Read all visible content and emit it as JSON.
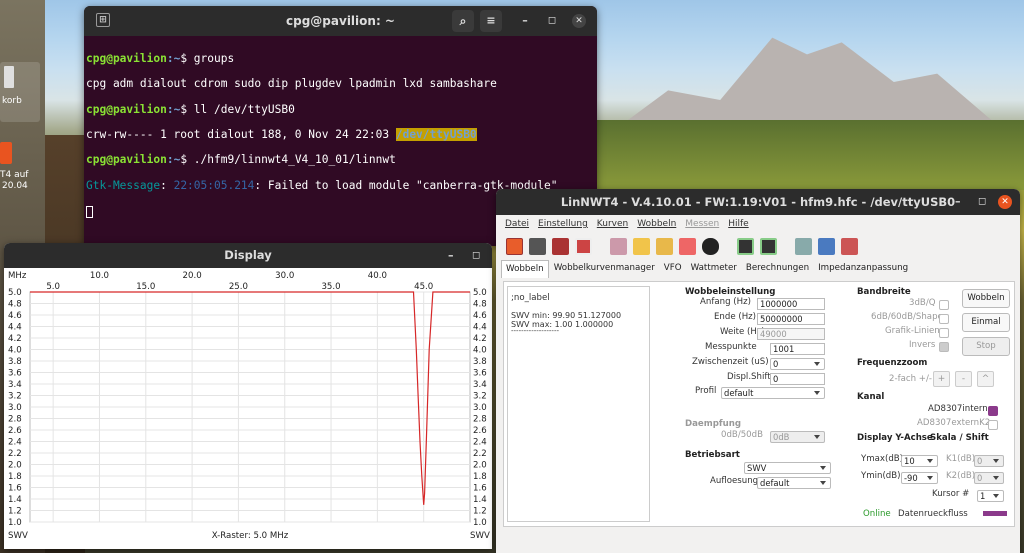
{
  "desktop": {
    "dock_item_1": "korb",
    "dock_item_2a": "T4 auf",
    "dock_item_2b": "20.04"
  },
  "terminal": {
    "title": "cpg@pavilion: ~",
    "lines": [
      {
        "user": "cpg@pavilion",
        "path": ":~",
        "cmd": "$ groups"
      },
      {
        "out": "cpg adm dialout cdrom sudo dip plugdev lpadmin lxd sambashare"
      },
      {
        "user": "cpg@pavilion",
        "path": ":~",
        "cmd": "$ ll /dev/ttyUSB0"
      },
      {
        "out": "crw-rw---- 1 root dialout 188, 0 Nov 24 22:03 ",
        "hl": "/dev/ttyUSB0"
      },
      {
        "user": "cpg@pavilion",
        "path": ":~",
        "cmd": "$ ./hfm9/linnwt4_V4_10_01/linnwt"
      },
      {
        "src": "Gtk-Message",
        "ts": "22:05:05.214",
        "msg": ": Failed to load module \"canberra-gtk-module\""
      }
    ]
  },
  "display": {
    "title": "Display",
    "x_unit": "MHz",
    "x_ticks_top": [
      "10.0",
      "20.0",
      "30.0",
      "40.0"
    ],
    "x_ticks_bottom": [
      "5.0",
      "15.0",
      "25.0",
      "35.0",
      "45.0"
    ],
    "y_ticks": [
      "5.0",
      "4.8",
      "4.6",
      "4.4",
      "4.2",
      "4.0",
      "3.8",
      "3.6",
      "3.4",
      "3.2",
      "3.0",
      "2.8",
      "2.6",
      "2.4",
      "2.2",
      "2.0",
      "1.8",
      "1.6",
      "1.4",
      "1.2",
      "1.0"
    ],
    "left_label": "SWV",
    "right_label": "SWV",
    "footer": "X-Raster: 5.0 MHz",
    "trace_color": "#d62728"
  },
  "chart_data": {
    "type": "line",
    "x": [
      2.5,
      43.0,
      43.9,
      44.2,
      44.4,
      44.6,
      44.8,
      45.0,
      45.1,
      45.3,
      45.6,
      46.0,
      46.4,
      50.0
    ],
    "y": [
      5.0,
      5.0,
      5.0,
      4.0,
      3.2,
      2.4,
      1.8,
      1.3,
      1.5,
      2.5,
      4.0,
      5.0,
      5.0,
      5.0
    ],
    "xlim": [
      2.5,
      50.0
    ],
    "ylim": [
      1.0,
      5.0
    ],
    "xlabel": "MHz",
    "ylabel": "SWV",
    "grid": true
  },
  "linnwt": {
    "title": "LinNWT4 - V.4.10.01 - FW:1.19:V01 - hfm9.hfc - /dev/ttyUSB0",
    "menu": [
      "Datei",
      "Einstellung",
      "Kurven",
      "Wobbeln",
      "Messen",
      "Hilfe"
    ],
    "tabs": [
      "Wobbeln",
      "Wobbelkurvenmanager",
      "VFO",
      "Wattmeter",
      "Berechnungen",
      "Impedanzanpassung"
    ],
    "info": {
      "label": ";no_label",
      "swv_min": "SWV min: 99.90  51.127000",
      "swv_max": "SWV max: 1.00  1.000000",
      "sep": "-------------------"
    },
    "wobbel": {
      "heading": "Wobbeleinstellung",
      "anfang_label": "Anfang (Hz)",
      "anfang": "1000000",
      "ende_label": "Ende (Hz)",
      "ende": "50000000",
      "weite_label": "Weite (Hz)",
      "weite": "49000",
      "messpunkte_label": "Messpunkte",
      "messpunkte": "1001",
      "zwischenzeit_label": "Zwischenzeit (uS)",
      "zwischenzeit": "0",
      "displshift_label": "Displ.Shift",
      "displshift": "0",
      "profil_label": "Profil",
      "profil": "default"
    },
    "daempfung": {
      "heading": "Daempfung",
      "label": "0dB/50dB",
      "value": "0dB"
    },
    "betriebsart": {
      "heading": "Betriebsart",
      "mode": "SWV",
      "aufl_label": "Aufloesung",
      "aufl": "default"
    },
    "bandbreite": {
      "heading": "Bandbreite",
      "q": "3dB/Q",
      "shape": "6dB/60dB/Shape",
      "grafik": "Grafik-Linien",
      "invers": "Invers"
    },
    "buttons": {
      "wobbeln": "Wobbeln",
      "einmal": "Einmal",
      "stop": "Stop"
    },
    "zoom": {
      "heading": "Frequenzzoom",
      "label": "2-fach +/-",
      "plus": "+",
      "minus": "-",
      "reset": "^"
    },
    "kanal": {
      "heading": "Kanal",
      "intern": "AD8307intern",
      "extern": "AD8307externK2"
    },
    "yachse": {
      "heading": "Display Y-Achse",
      "shift_heading": "Skala / Shift",
      "ymax_label": "Ymax(dB)",
      "ymax": "10",
      "ymin_label": "Ymin(dB)",
      "ymin": "-90",
      "k1_label": "K1(dB)",
      "k1": "0",
      "k2_label": "K2(dB)",
      "k2": "0",
      "kursor_label": "Kursor #",
      "kursor": "1"
    },
    "status": {
      "online": "Online",
      "flow": "Datenrueckfluss"
    }
  }
}
